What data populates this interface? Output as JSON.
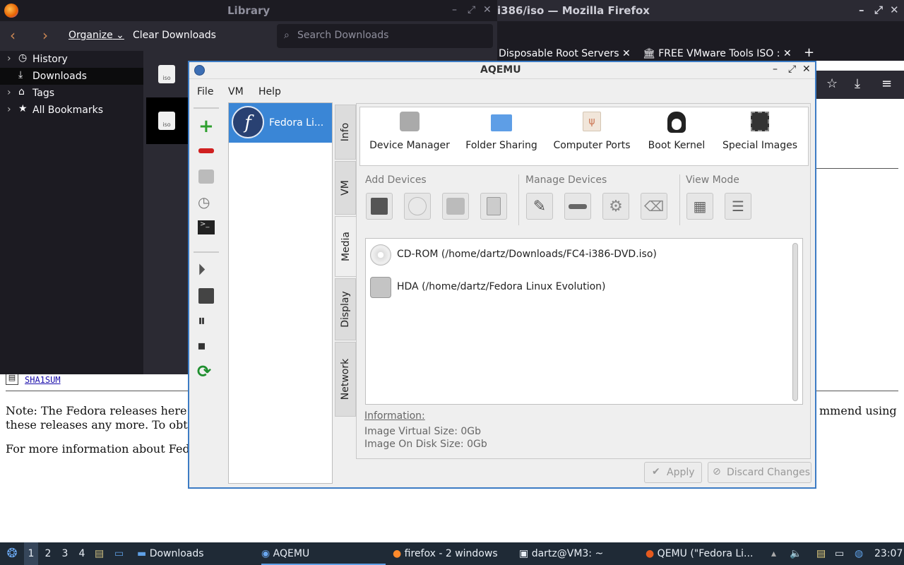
{
  "firefox": {
    "title": "i386/iso — Mozilla Firefox",
    "tabs": [
      {
        "label": "Disposable Root Servers"
      },
      {
        "label": "FREE VMware Tools ISO :"
      }
    ],
    "page": {
      "sha1_link": "SHA1SUM",
      "note_line1a": "Note: The Fedora releases here",
      "note_line1b": "mmend using",
      "note_line2": "these releases any more. To obt",
      "info_line": "For more information about Fed"
    }
  },
  "library": {
    "title": "Library",
    "toolbar": {
      "organize": "Organize",
      "clear": "Clear Downloads",
      "search_placeholder": "Search Downloads"
    },
    "sidebar": [
      {
        "label": "History"
      },
      {
        "label": "Downloads"
      },
      {
        "label": "Tags"
      },
      {
        "label": "All Bookmarks"
      }
    ],
    "download_badge": "iso"
  },
  "aqemu": {
    "title": "AQEMU",
    "menu": [
      "File",
      "VM",
      "Help"
    ],
    "vm_list": [
      {
        "name": "Fedora Li..."
      }
    ],
    "vtabs": [
      "Info",
      "VM",
      "Media",
      "Display",
      "Network"
    ],
    "top_icons": [
      {
        "label": "Device Manager"
      },
      {
        "label": "Folder Sharing"
      },
      {
        "label": "Computer Ports"
      },
      {
        "label": "Boot Kernel"
      },
      {
        "label": "Special Images"
      }
    ],
    "groups": {
      "add": "Add Devices",
      "manage": "Manage Devices",
      "view": "View Mode"
    },
    "devices": [
      {
        "label": "CD-ROM (/home/dartz/Downloads/FC4-i386-DVD.iso)",
        "icon": "cdrom-icon"
      },
      {
        "label": "HDA (/home/dartz/Fedora Linux Evolution)",
        "icon": "harddisk-icon"
      }
    ],
    "info": {
      "heading": "Information:",
      "virtual": "Image Virtual Size: 0Gb",
      "disk": "Image On Disk Size: 0Gb"
    },
    "buttons": {
      "apply": "Apply",
      "discard": "Discard Changes"
    }
  },
  "taskbar": {
    "workspaces": [
      "1",
      "2",
      "3",
      "4"
    ],
    "items": [
      {
        "label": "Downloads"
      },
      {
        "label": "AQEMU"
      },
      {
        "label": "firefox - 2 windows"
      },
      {
        "label": "dartz@VM3: ~"
      },
      {
        "label": "QEMU (\"Fedora Li..."
      }
    ],
    "clock": "23:07"
  },
  "colors": {
    "accent": "#3c7bc4",
    "dark": "#2b2a33",
    "taskbar": "#1f2a36"
  }
}
